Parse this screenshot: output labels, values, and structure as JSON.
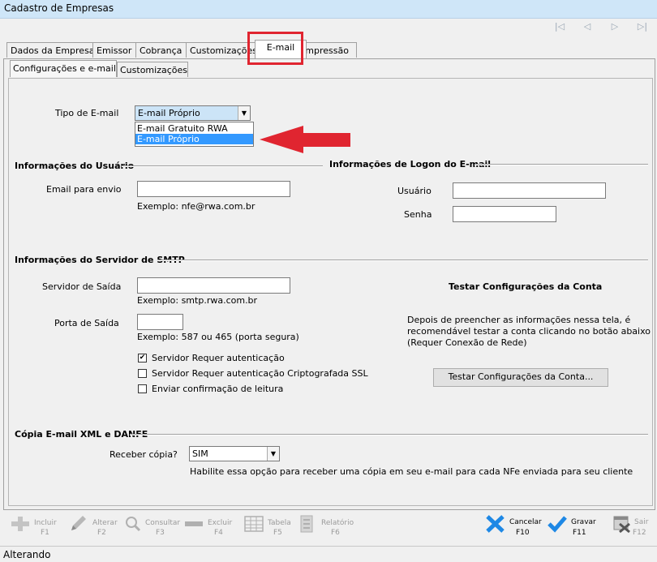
{
  "window": {
    "title": "Cadastro de Empresas"
  },
  "nav_icons": [
    "first-icon",
    "prev-icon",
    "next-icon",
    "last-icon"
  ],
  "tabs": [
    {
      "label": "Dados da Empresa"
    },
    {
      "label": "Emissor"
    },
    {
      "label": "Cobrança"
    },
    {
      "label": "Customizações"
    },
    {
      "label": "E-mail"
    },
    {
      "label": "Impressão"
    }
  ],
  "subtabs": [
    {
      "label": "Configurações e e-mail"
    },
    {
      "label": "Customizações"
    }
  ],
  "email_type": {
    "label": "Tipo de E-mail",
    "value": "E-mail Próprio",
    "options": [
      "E-mail Gratuito RWA",
      "E-mail Próprio"
    ]
  },
  "user_info": {
    "title": "Informações do Usuário",
    "email_label": "Email para envio",
    "email_value": "",
    "email_example": "Exemplo: nfe@rwa.com.br"
  },
  "logon_info": {
    "title": "Informações de Logon do E-mail",
    "user_label": "Usuário",
    "user_value": "",
    "password_label": "Senha",
    "password_value": ""
  },
  "smtp": {
    "title": "Informações do Servidor de SMTP",
    "server_label": "Servidor de Saída",
    "server_value": "",
    "server_example": "Exemplo: smtp.rwa.com.br",
    "port_label": "Porta de Saída",
    "port_value": "",
    "port_example": "Exemplo: 587 ou 465 (porta segura)",
    "checkboxes": [
      {
        "label": "Servidor Requer autenticação",
        "checked": true
      },
      {
        "label": "Servidor Requer autenticação Criptografada SSL",
        "checked": false
      },
      {
        "label": "Enviar confirmação de leitura",
        "checked": false
      }
    ]
  },
  "test": {
    "title": "Testar Configurações da Conta",
    "description_lines": [
      "Depois de preencher as informações nessa tela, é",
      "recomendável testar a conta clicando no botão abaixo",
      "(Requer Conexão de Rede)"
    ],
    "button_label": "Testar Configurações da Conta..."
  },
  "copy": {
    "title": "Cópia E-mail XML e DANFE",
    "label": "Receber cópia?",
    "value": "SIM",
    "hint": "Habilite essa opção para receber uma cópia em seu e-mail para cada NFe enviada para seu cliente"
  },
  "toolbar": [
    {
      "label": "Incluir",
      "key": "F1",
      "icon": "plus-icon",
      "enabled": false
    },
    {
      "label": "Alterar",
      "key": "F2",
      "icon": "pencil-icon",
      "enabled": false
    },
    {
      "label": "Consultar",
      "key": "F3",
      "icon": "search-icon",
      "enabled": false
    },
    {
      "label": "Excluir",
      "key": "F4",
      "icon": "minus-icon",
      "enabled": false
    },
    {
      "label": "Tabela",
      "key": "F5",
      "icon": "table-icon",
      "enabled": false
    },
    {
      "label": "Relatório",
      "key": "F6",
      "icon": "report-icon",
      "enabled": false
    },
    {
      "label": "Cancelar",
      "key": "F10",
      "icon": "cancel-icon",
      "enabled": true
    },
    {
      "label": "Gravar",
      "key": "F11",
      "icon": "save-check-icon",
      "enabled": true
    },
    {
      "label": "Sair",
      "key": "F12",
      "icon": "exit-icon",
      "enabled": false
    }
  ],
  "status": {
    "text": "Alterando"
  },
  "colors": {
    "title_bg": "#cfe6f8",
    "selection": "#3399ff",
    "annotation": "#e02530",
    "cancel_icon": "#1e88e5",
    "save_icon": "#1e88e5"
  }
}
